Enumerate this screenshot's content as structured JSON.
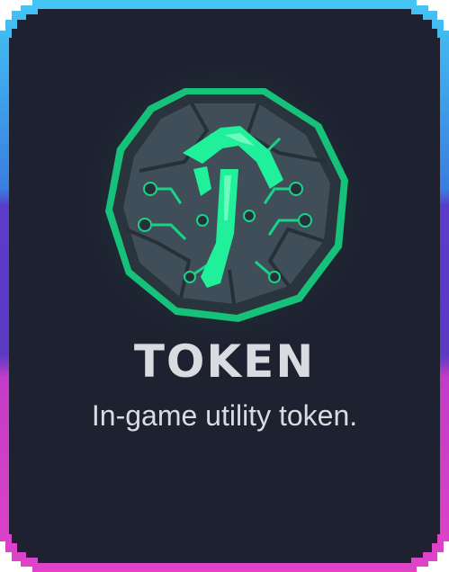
{
  "card": {
    "title": "TOKEN",
    "description": "In-game utility token.",
    "icon": "rune-token-coin-icon"
  },
  "colors": {
    "background": "#1e2130",
    "border_top": "#3fb8f0",
    "border_middle": "#5a3cc8",
    "border_bottom": "#d23cc8",
    "glow": "#1fe58f",
    "coin_stone": "#3b4a55",
    "title_text": "#d8dbe0"
  }
}
